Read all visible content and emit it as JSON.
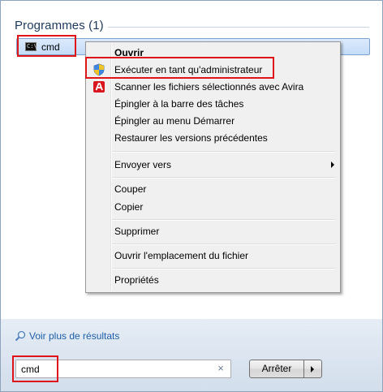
{
  "programs": {
    "header": "Programmes (1)",
    "result_label": "cmd",
    "result_icon": "command-prompt-icon"
  },
  "context_menu": {
    "items": [
      {
        "label": "Ouvrir",
        "bold": true
      },
      {
        "label": "Exécuter en tant qu'administrateur",
        "icon": "uac-shield-icon"
      },
      {
        "label": "Scanner les fichiers sélectionnés avec Avira",
        "icon": "avira-icon"
      },
      {
        "label": "Épingler à la barre des tâches"
      },
      {
        "label": "Épingler au menu Démarrer"
      },
      {
        "label": "Restaurer les versions précédentes"
      },
      {
        "label": "Envoyer vers",
        "submenu": true
      },
      {
        "label": "Couper"
      },
      {
        "label": "Copier"
      },
      {
        "label": "Supprimer"
      },
      {
        "label": "Ouvrir l'emplacement du fichier"
      },
      {
        "label": "Propriétés"
      }
    ]
  },
  "footer": {
    "see_more": "Voir plus de résultats",
    "search_value": "cmd",
    "clear_icon": "×",
    "shutdown_label": "Arrêter"
  },
  "colors": {
    "highlight_border": "#e0151a",
    "link": "#1e5fa8",
    "header": "#1e395b"
  }
}
